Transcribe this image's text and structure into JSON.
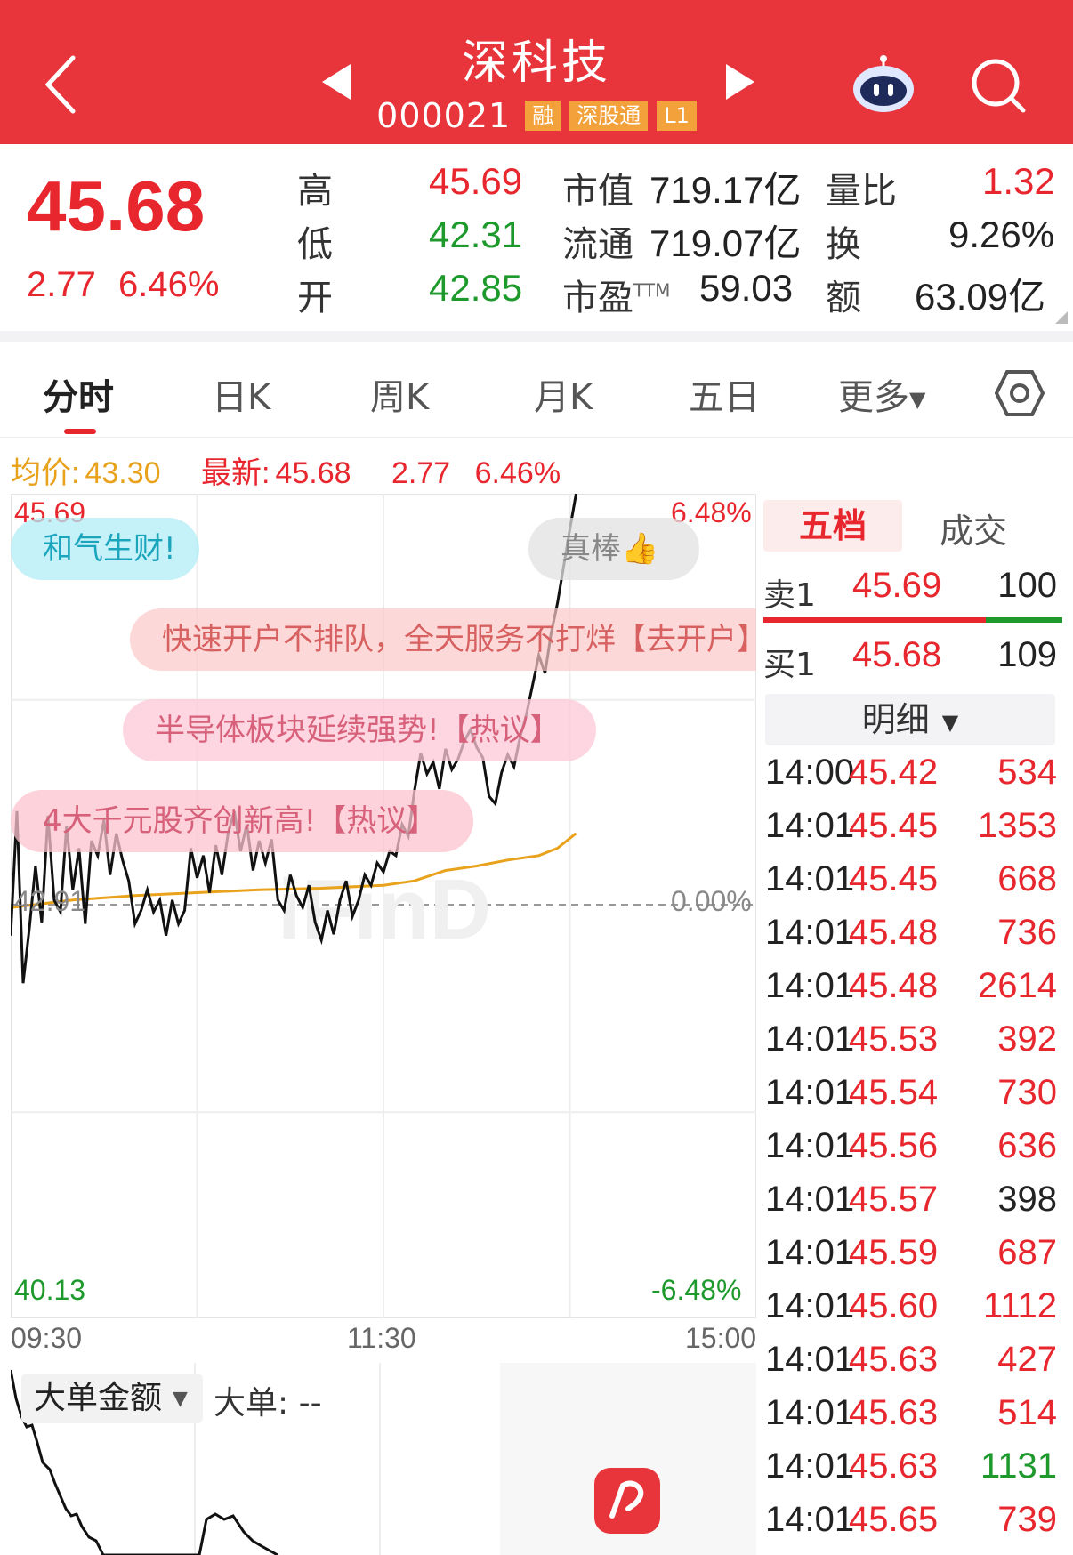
{
  "header": {
    "name": "深科技",
    "code": "000021",
    "tags": [
      "融",
      "深股通",
      "L1"
    ]
  },
  "quote": {
    "price": "45.68",
    "change": "2.77",
    "change_pct": "6.46%",
    "high_label": "高",
    "high": "45.69",
    "low_label": "低",
    "low": "42.31",
    "open_label": "开",
    "open": "42.85",
    "mktcap_label": "市值",
    "mktcap": "719.17亿",
    "float_label": "流通",
    "float": "719.07亿",
    "pe_label": "市盈",
    "pe_sup": "TTM",
    "pe": "59.03",
    "vol_ratio_label": "量比",
    "vol_ratio": "1.32",
    "turnover_label": "换",
    "turnover": "9.26%",
    "amount_label": "额",
    "amount": "63.09亿"
  },
  "tabs": [
    "分时",
    "日K",
    "周K",
    "月K",
    "五日",
    "更多"
  ],
  "info": {
    "avg_label": "均价:",
    "avg": "43.30",
    "latest_label": "最新:",
    "latest": "45.68",
    "change": "2.77",
    "change_pct": "6.46%"
  },
  "chart": {
    "top_price": "45.69",
    "top_pct": "6.48%",
    "mid_price": "42.91",
    "mid_pct": "0.00%",
    "bottom_price": "40.13",
    "bottom_pct": "-6.48%",
    "time_start": "09:30",
    "time_mid": "11:30",
    "time_end": "15:00"
  },
  "chart_data": {
    "type": "line",
    "ylim": [
      40.13,
      45.69
    ],
    "x_range": [
      0,
      240
    ],
    "series": [
      {
        "values": [
          [
            0,
            42.71
          ],
          [
            2,
            43.55
          ],
          [
            4,
            42.39
          ],
          [
            6,
            42.76
          ],
          [
            8,
            43.18
          ],
          [
            10,
            42.8
          ],
          [
            12,
            43.52
          ],
          [
            14,
            42.95
          ],
          [
            16,
            42.87
          ],
          [
            18,
            43.45
          ],
          [
            20,
            43.02
          ],
          [
            22,
            43.3
          ],
          [
            24,
            42.79
          ],
          [
            26,
            43.35
          ],
          [
            28,
            43.25
          ],
          [
            30,
            43.49
          ],
          [
            32,
            43.12
          ],
          [
            34,
            43.4
          ],
          [
            36,
            43.22
          ],
          [
            38,
            43.08
          ],
          [
            40,
            42.79
          ],
          [
            42,
            42.88
          ],
          [
            44,
            43.02
          ],
          [
            46,
            42.87
          ],
          [
            48,
            42.95
          ],
          [
            50,
            42.71
          ],
          [
            52,
            42.95
          ],
          [
            54,
            42.79
          ],
          [
            56,
            42.88
          ],
          [
            58,
            43.3
          ],
          [
            60,
            43.1
          ],
          [
            62,
            43.25
          ],
          [
            64,
            43.0
          ],
          [
            66,
            43.32
          ],
          [
            68,
            43.12
          ],
          [
            70,
            43.4
          ],
          [
            72,
            43.55
          ],
          [
            74,
            43.28
          ],
          [
            76,
            43.46
          ],
          [
            78,
            43.15
          ],
          [
            80,
            43.35
          ],
          [
            82,
            43.2
          ],
          [
            84,
            43.36
          ],
          [
            86,
            42.95
          ],
          [
            88,
            42.88
          ],
          [
            90,
            43.12
          ],
          [
            92,
            42.98
          ],
          [
            94,
            42.9
          ],
          [
            96,
            43.05
          ],
          [
            98,
            42.8
          ],
          [
            100,
            42.68
          ],
          [
            102,
            42.88
          ],
          [
            104,
            42.72
          ],
          [
            106,
            42.95
          ],
          [
            108,
            43.08
          ],
          [
            110,
            42.84
          ],
          [
            112,
            42.95
          ],
          [
            114,
            43.12
          ],
          [
            116,
            43.05
          ],
          [
            118,
            43.2
          ],
          [
            120,
            43.14
          ],
          [
            122,
            43.28
          ],
          [
            124,
            43.25
          ],
          [
            126,
            43.46
          ],
          [
            128,
            43.38
          ],
          [
            130,
            43.69
          ],
          [
            132,
            43.94
          ],
          [
            134,
            43.8
          ],
          [
            136,
            43.88
          ],
          [
            138,
            43.7
          ],
          [
            140,
            43.97
          ],
          [
            142,
            43.83
          ],
          [
            144,
            43.9
          ],
          [
            146,
            44.02
          ],
          [
            148,
            44.1
          ],
          [
            150,
            43.98
          ],
          [
            152,
            43.91
          ],
          [
            154,
            43.65
          ],
          [
            156,
            43.6
          ],
          [
            158,
            43.81
          ],
          [
            160,
            43.93
          ],
          [
            162,
            43.85
          ],
          [
            164,
            44.05
          ],
          [
            166,
            44.2
          ],
          [
            168,
            44.4
          ],
          [
            170,
            44.6
          ],
          [
            172,
            44.48
          ],
          [
            174,
            44.75
          ],
          [
            176,
            44.95
          ],
          [
            178,
            45.2
          ],
          [
            180,
            45.45
          ],
          [
            182,
            45.69
          ]
        ]
      },
      {
        "name": "均价",
        "values": [
          [
            0,
            42.9
          ],
          [
            20,
            42.95
          ],
          [
            40,
            42.98
          ],
          [
            60,
            43.0
          ],
          [
            80,
            43.02
          ],
          [
            100,
            43.03
          ],
          [
            120,
            43.05
          ],
          [
            130,
            43.08
          ],
          [
            140,
            43.15
          ],
          [
            150,
            43.18
          ],
          [
            160,
            43.22
          ],
          [
            170,
            43.25
          ],
          [
            176,
            43.3
          ],
          [
            182,
            43.4
          ]
        ]
      }
    ]
  },
  "bubbles": {
    "b1": "和气生财!",
    "b2": "真棒👍",
    "b3": "快速开户不排队，全天服务不打烊【去开户】",
    "b4": "半导体板块延续强势!【热议】",
    "b5": "4大千元股齐创新高!【热议】"
  },
  "bottom": {
    "select": "大单金额",
    "bigorder_label": "大单: --"
  },
  "orderbook": {
    "tab_active": "五档",
    "tab_other": "成交",
    "sell1_label": "卖1",
    "sell1_price": "45.69",
    "sell1_vol": "100",
    "buy1_label": "买1",
    "buy1_price": "45.68",
    "buy1_vol": "109",
    "detail": "明细"
  },
  "trades": [
    {
      "time": "14:00",
      "price": "45.42",
      "vol": "534",
      "dir": "red"
    },
    {
      "time": "14:01",
      "price": "45.45",
      "vol": "1353",
      "dir": "red"
    },
    {
      "time": "14:01",
      "price": "45.45",
      "vol": "668",
      "dir": "red"
    },
    {
      "time": "14:01",
      "price": "45.48",
      "vol": "736",
      "dir": "red"
    },
    {
      "time": "14:01",
      "price": "45.48",
      "vol": "2614",
      "dir": "red"
    },
    {
      "time": "14:01",
      "price": "45.53",
      "vol": "392",
      "dir": "red"
    },
    {
      "time": "14:01",
      "price": "45.54",
      "vol": "730",
      "dir": "red"
    },
    {
      "time": "14:01",
      "price": "45.56",
      "vol": "636",
      "dir": "red"
    },
    {
      "time": "14:01",
      "price": "45.57",
      "vol": "398",
      "dir": "dark"
    },
    {
      "time": "14:01",
      "price": "45.59",
      "vol": "687",
      "dir": "red"
    },
    {
      "time": "14:01",
      "price": "45.60",
      "vol": "1112",
      "dir": "red"
    },
    {
      "time": "14:01",
      "price": "45.63",
      "vol": "427",
      "dir": "red"
    },
    {
      "time": "14:01",
      "price": "45.63",
      "vol": "514",
      "dir": "red"
    },
    {
      "time": "14:01",
      "price": "45.63",
      "vol": "1131",
      "dir": "green"
    },
    {
      "time": "14:01",
      "price": "45.65",
      "vol": "739",
      "dir": "red"
    }
  ],
  "colors": {
    "header": "#e8343b",
    "up": "#e8262d",
    "down": "#1e9a2c",
    "avg": "#e8a21c"
  }
}
